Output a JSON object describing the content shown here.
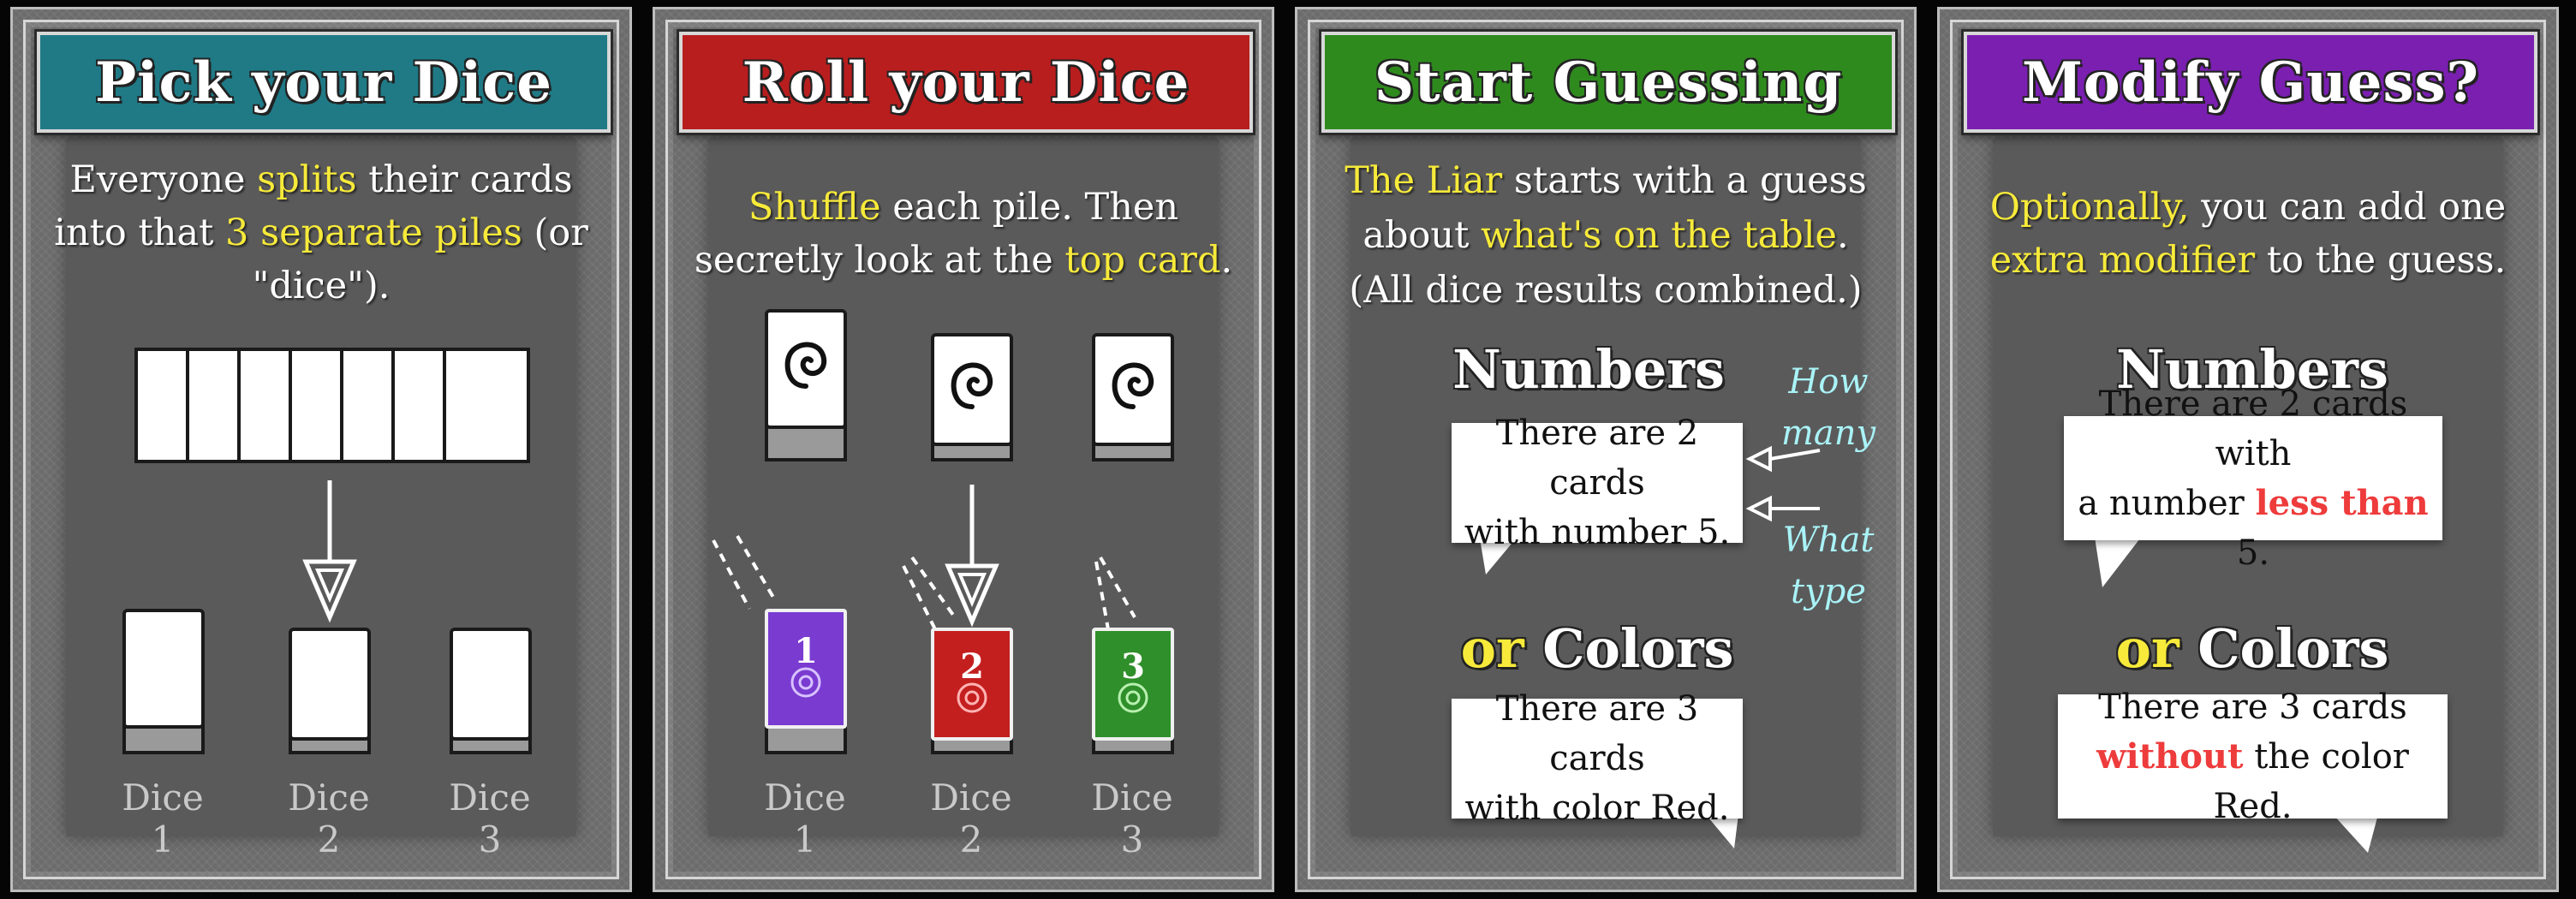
{
  "colors": {
    "panel1": "#1f7a86",
    "panel2": "#b81e1e",
    "panel3": "#2f8a1e",
    "panel4": "#7a1fb0",
    "highlight": "#f7ea3a",
    "note": "#a9f3f7",
    "warn": "#ee3b3b"
  },
  "panel1": {
    "title": "Pick your Dice",
    "line1_a": "Everyone ",
    "line1_hl": "splits",
    "line1_b": " their cards",
    "line2_a": "into that ",
    "line2_hl": "3 separate piles",
    "line2_b": " (or",
    "line3": "\"dice\").",
    "dice1": "Dice 1",
    "dice2": "Dice 2",
    "dice3": "Dice 3",
    "arrow_icon": "down-arrow-icon"
  },
  "panel2": {
    "title": "Roll your Dice",
    "line1_hl": "Shuffle",
    "line1_b": " each pile. Then",
    "line2_a": "secretly look at the ",
    "line2_hl": "top card",
    "line2_b": ".",
    "dice1": "Dice 1",
    "dice2": "Dice 2",
    "dice3": "Dice 3",
    "card1_number": "1",
    "card2_number": "2",
    "card3_number": "3",
    "card_back_icon": "spiral-icon"
  },
  "panel3": {
    "title": "Start Guessing",
    "line1_hl": "The Liar",
    "line1_b": " starts with a guess",
    "line2_a": "about ",
    "line2_hl": "what's on the table",
    "line2_b": ".",
    "line3": "(All dice results combined.)",
    "heading_numbers": "Numbers",
    "bubble1_line1": "There are 2 cards",
    "bubble1_line2": "with number 5.",
    "heading_or": "or",
    "heading_colors": " Colors",
    "bubble2_line1": "There are 3 cards",
    "bubble2_line2": "with color Red.",
    "note_how": "How",
    "note_many": "many",
    "note_what": "What",
    "note_type": "type"
  },
  "panel4": {
    "title": "Modify Guess?",
    "line1_hl": "Optionally,",
    "line1_b": " you can add one",
    "line2_hl": "extra modifier",
    "line2_b": " to the guess.",
    "heading_numbers": "Numbers",
    "bubble1_line1": "There are 2 cards with",
    "bubble1_line2_a": "a number ",
    "bubble1_line2_red": "less than",
    "bubble1_line2_b": " 5.",
    "heading_or": "or",
    "heading_colors": " Colors",
    "bubble2_line1": "There are 3 cards",
    "bubble2_line2_red": "without",
    "bubble2_line2_b": " the color Red."
  }
}
